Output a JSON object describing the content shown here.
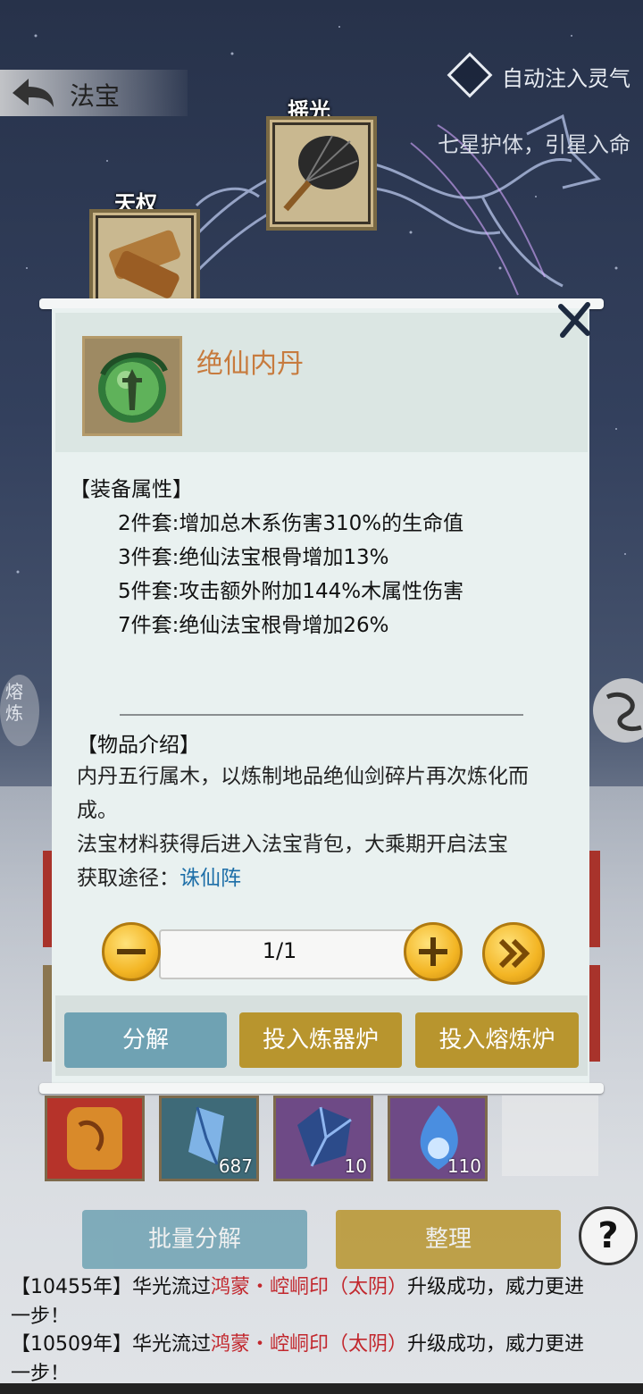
{
  "header": {
    "title": "法宝",
    "auto_inject_label": "自动注入灵气",
    "subtitle": "七星护体，引星入命"
  },
  "stars": {
    "yaoguang": "摇光",
    "tianquan": "天权"
  },
  "side": {
    "left_label": "熔炼"
  },
  "modal": {
    "item_name": "绝仙内丹",
    "attr_title": "【装备属性】",
    "attrs": [
      "2件套:增加总木系伤害310%的生命值",
      "3件套:绝仙法宝根骨增加13%",
      "5件套:攻击额外附加144%木属性伤害",
      "7件套:绝仙法宝根骨增加26%"
    ],
    "intro_title": "【物品介绍】",
    "intro_line1": "内丹五行属木，以炼制地品绝仙剑碎片再次炼化而",
    "intro_line2": "成。",
    "intro_line3": "法宝材料获得后进入法宝背包，大乘期开启法宝",
    "source_label": "获取途径：",
    "source_link": "诛仙阵",
    "quantity": "1/1",
    "btn_decompose": "分解",
    "btn_forge": "投入炼器炉",
    "btn_smelt": "投入熔炼炉"
  },
  "inventory": [
    {
      "count": ""
    },
    {
      "count": "687"
    },
    {
      "count": "10"
    },
    {
      "count": "110"
    }
  ],
  "bottom": {
    "batch_decompose": "批量分解",
    "organize": "整理",
    "help": "?"
  },
  "log": [
    {
      "prefix": "【10455年】华光流过",
      "item": "鸿蒙・崆峒印（太阴）",
      "suffix": "升级成功，威力更进",
      "cont": "一步！"
    },
    {
      "prefix": "【10509年】华光流过",
      "item": "鸿蒙・崆峒印（太阴）",
      "suffix": "升级成功，威力更进",
      "cont": "一步！"
    }
  ],
  "colors": {
    "item_name": "#c77b3e",
    "link": "#1e6fa8",
    "decompose_btn": "#6fa2b3",
    "forge_btn": "#b8952e",
    "log_highlight": "#c2272d"
  }
}
